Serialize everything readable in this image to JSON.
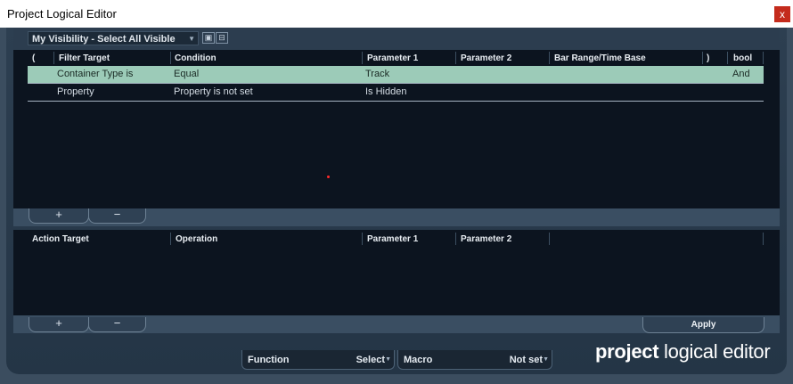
{
  "window": {
    "title": "Project Logical Editor",
    "close_glyph": "x"
  },
  "preset": {
    "name": "My Visibility - Select All Visible",
    "store_icon": "store-preset-icon",
    "remove_icon": "remove-preset-icon"
  },
  "filter": {
    "headers": [
      "(",
      "Filter Target",
      "Condition",
      "Parameter 1",
      "Parameter 2",
      "Bar Range/Time Base",
      ")",
      "bool"
    ],
    "rows": [
      {
        "paren_open": "",
        "target": "Container Type is",
        "condition": "Equal",
        "param1": "Track",
        "param2": "",
        "bar_range": "",
        "paren_close": "",
        "bool": "And",
        "selected": true
      },
      {
        "paren_open": "",
        "target": "Property",
        "condition": "Property is not set",
        "param1": "Is Hidden",
        "param2": "",
        "bar_range": "",
        "paren_close": "",
        "bool": "",
        "selected": false
      }
    ],
    "add_label": "+",
    "remove_label": "−"
  },
  "action": {
    "headers": [
      "Action Target",
      "Operation",
      "Parameter 1",
      "Parameter 2"
    ],
    "add_label": "+",
    "remove_label": "−",
    "apply_label": "Apply"
  },
  "footer": {
    "function_label": "Function",
    "function_value": "Select",
    "macro_label": "Macro",
    "macro_value": "Not set",
    "brand_bold": "project",
    "brand_light": " logical editor"
  },
  "colors": {
    "selected_row": "#9ccbb8",
    "table_bg": "#0c141f",
    "panel": "#2d3f51",
    "close_button": "#c42b1c"
  }
}
